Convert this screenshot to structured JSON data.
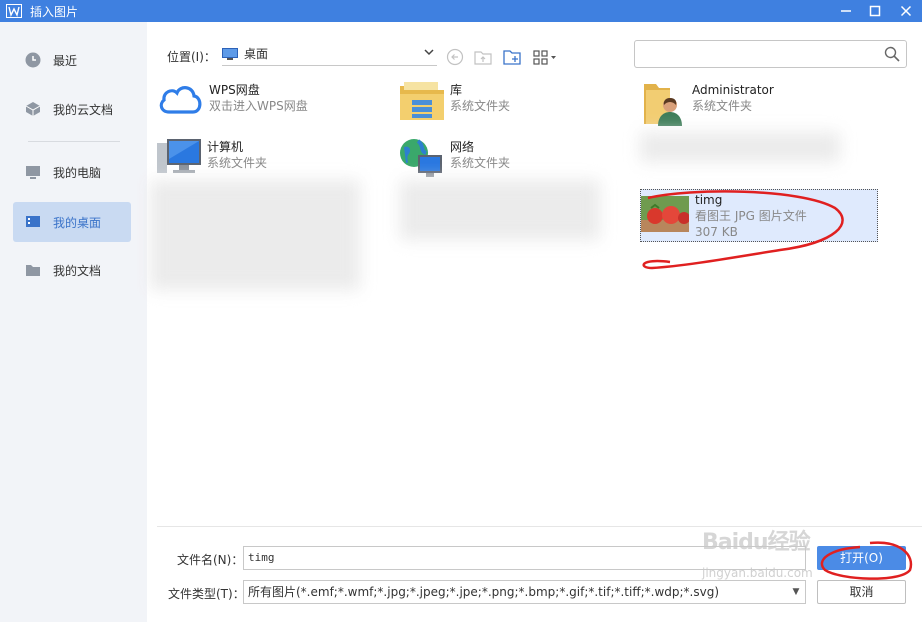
{
  "window": {
    "title": "插入图片",
    "accent": "#3f80e0"
  },
  "sidebar": {
    "items": [
      {
        "label": "最近",
        "icon": "clock-icon"
      },
      {
        "label": "我的云文档",
        "icon": "cloud-box-icon"
      },
      {
        "label": "我的电脑",
        "icon": "monitor-icon"
      },
      {
        "label": "我的桌面",
        "icon": "desktop-icon",
        "active": true
      },
      {
        "label": "我的文档",
        "icon": "folder-icon"
      }
    ]
  },
  "toolbar": {
    "location_label": "位置(I)：",
    "location_value": "桌面"
  },
  "files": [
    {
      "name": "WPS网盘",
      "sub": "双击进入WPS网盘",
      "icon": "cloud-icon"
    },
    {
      "name": "库",
      "sub": "系统文件夹",
      "icon": "library-folder-icon"
    },
    {
      "name": "Administrator",
      "sub": "系统文件夹",
      "icon": "user-folder-icon"
    },
    {
      "name": "计算机",
      "sub": "系统文件夹",
      "icon": "computer-icon"
    },
    {
      "name": "网络",
      "sub": "系统文件夹",
      "icon": "network-globe-icon"
    },
    {
      "name": "timg",
      "sub": "看图王 JPG 图片文件",
      "sub2": "307 KB",
      "icon": "image-thumbnail-icon",
      "selected": true
    }
  ],
  "footer": {
    "filename_label": "文件名(N)：",
    "filename_value": "timg",
    "filetype_label": "文件类型(T)：",
    "filetype_value": "所有图片(*.emf;*.wmf;*.jpg;*.jpeg;*.jpe;*.png;*.bmp;*.gif;*.tif;*.tiff;*.wdp;*.svg)",
    "open_label": "打开(O)",
    "cancel_label": "取消"
  },
  "watermark": {
    "brand": "Baidu经验",
    "url": "jingyan.baidu.com"
  }
}
